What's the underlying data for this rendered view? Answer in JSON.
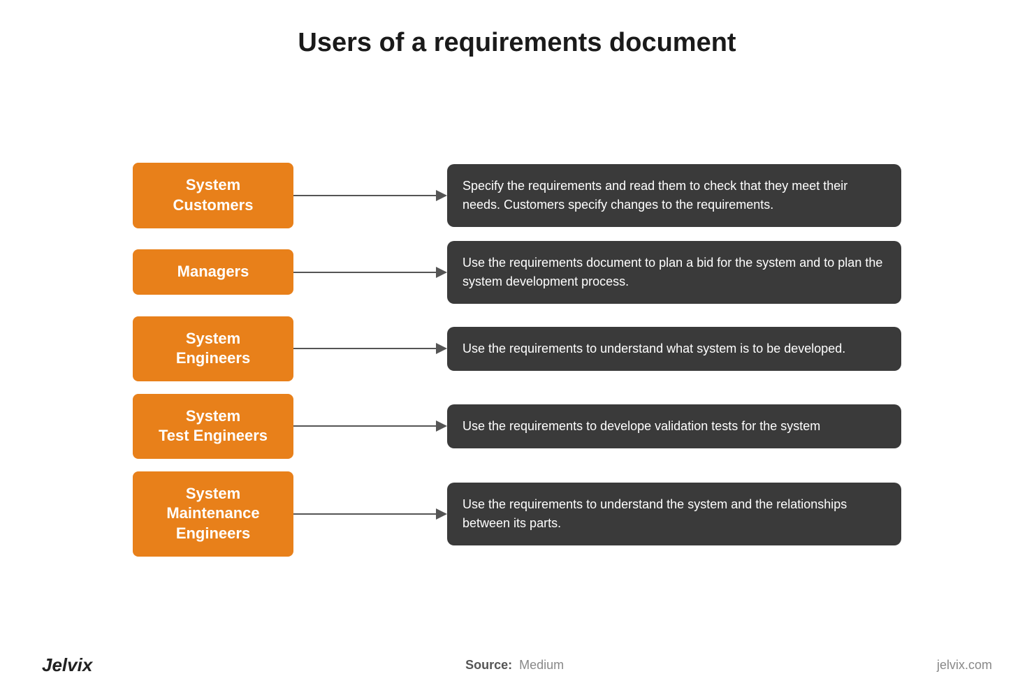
{
  "page": {
    "title": "Users of a requirements document",
    "accent_color": "#e8801a",
    "dark_box_color": "#3a3a3a"
  },
  "rows": [
    {
      "id": "system-customers",
      "label": "System\nCustomers",
      "description": "Specify the requirements and read them to check that they meet their needs. Customers specify changes to the requirements."
    },
    {
      "id": "managers",
      "label": "Managers",
      "description": "Use the requirements document to plan a bid for the system and to plan the system development process."
    },
    {
      "id": "system-engineers",
      "label": "System\nEngineers",
      "description": "Use the requirements to understand what system is to be developed."
    },
    {
      "id": "system-test-engineers",
      "label": "System\nTest Engineers",
      "description": "Use the requirements to develope validation tests for the system"
    },
    {
      "id": "system-maintenance-engineers",
      "label": "System\nMaintenance\nEngineers",
      "description": "Use the requirements to understand the system and the relationships between its parts."
    }
  ],
  "footer": {
    "brand_left": "Jelvix",
    "source_label": "Source:",
    "source_value": "Medium",
    "brand_right": "jelvix.com"
  }
}
